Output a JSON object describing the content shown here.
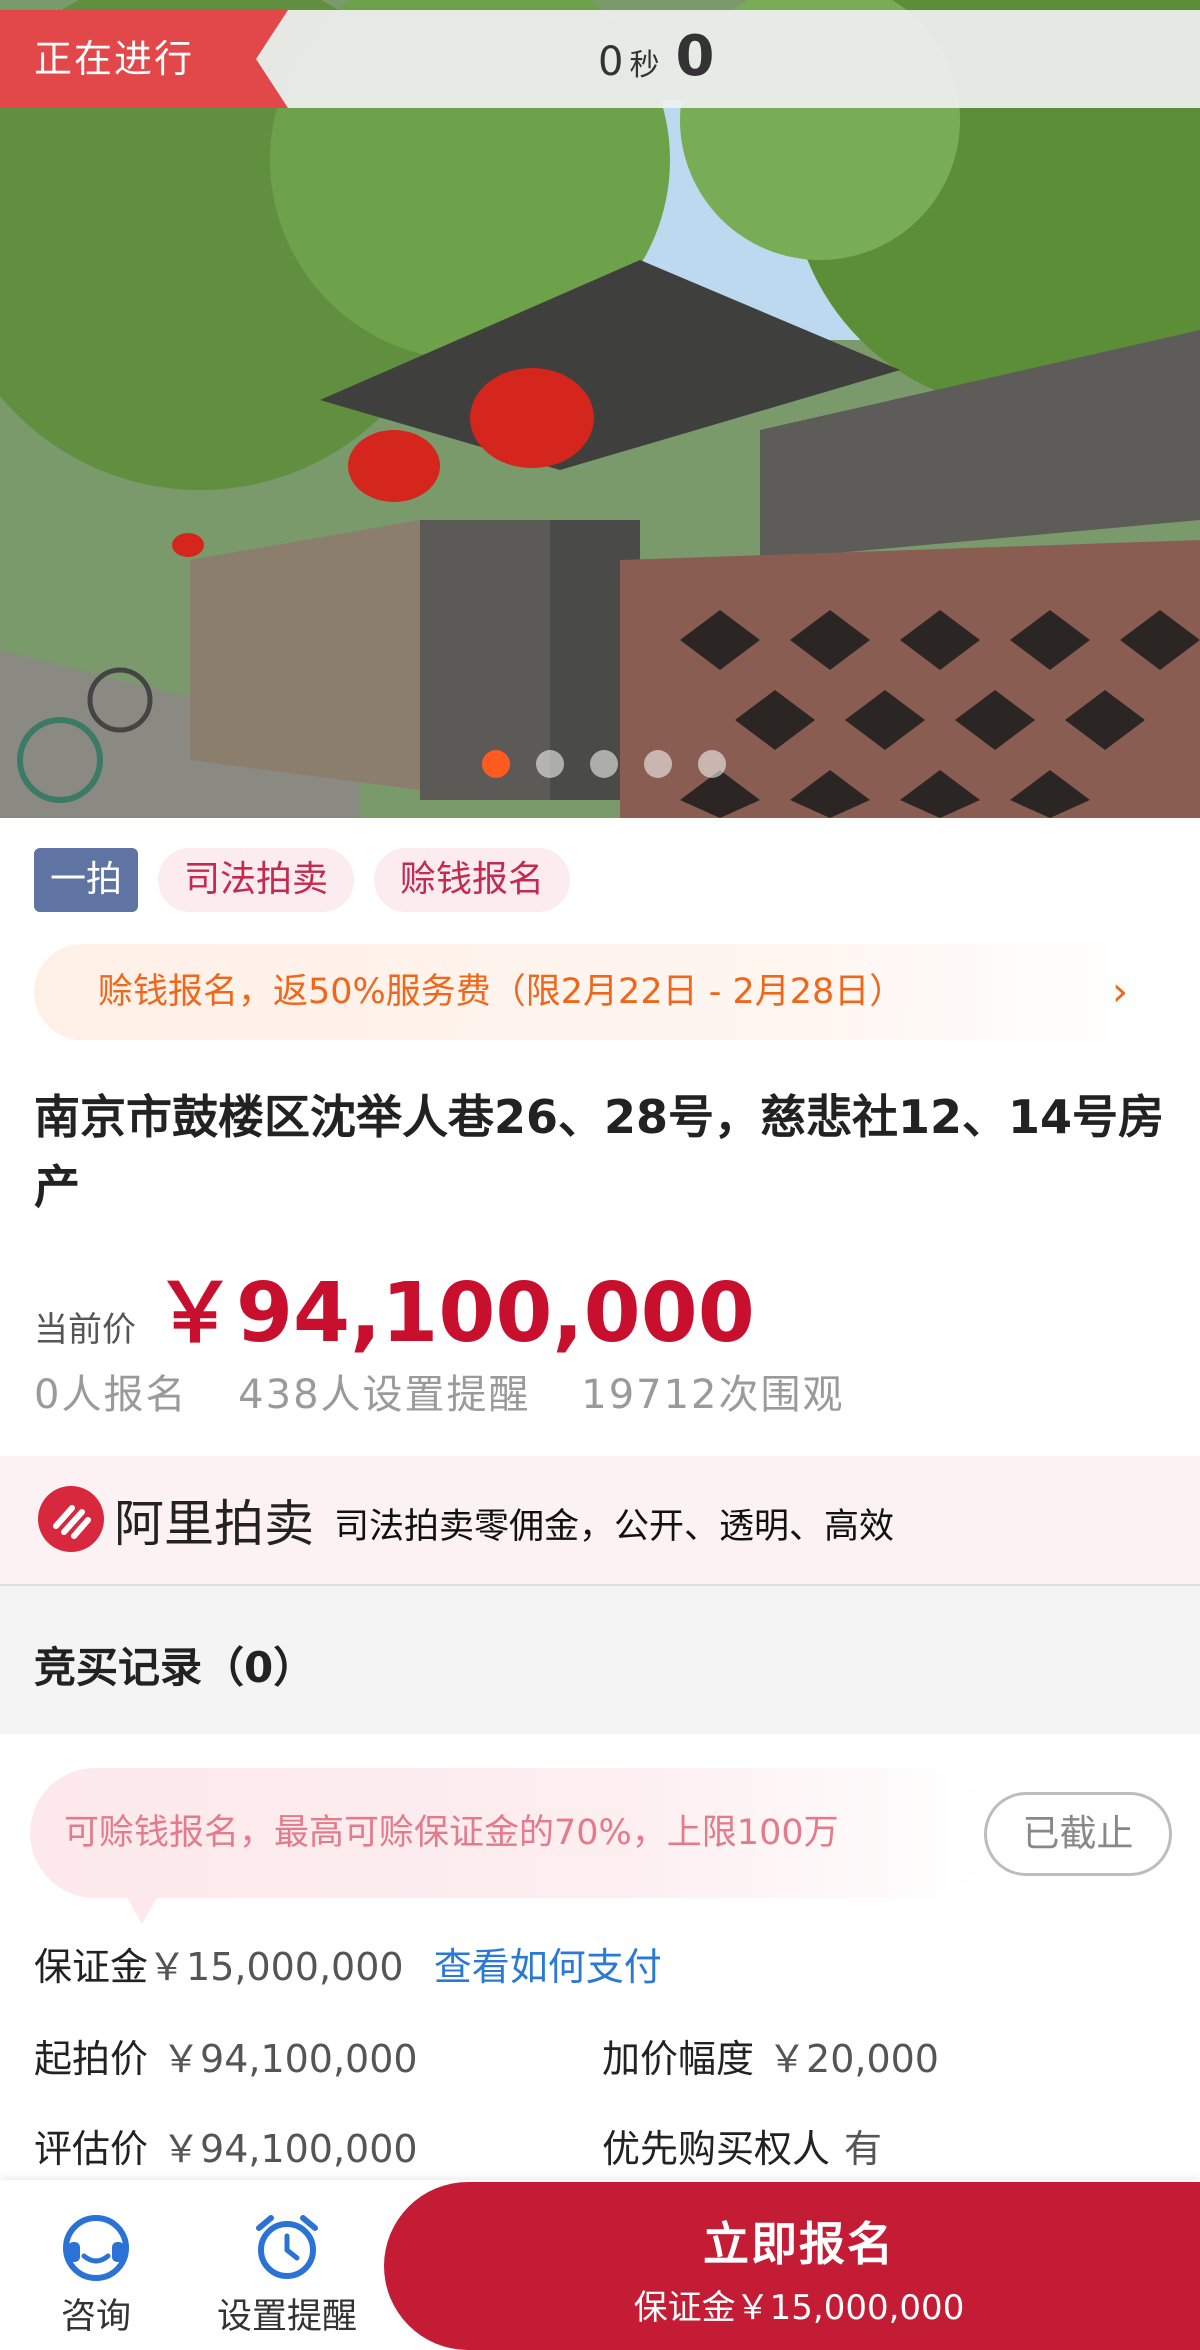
{
  "header": {
    "status": "正在进行",
    "countdown_num": "0",
    "countdown_unit": "秒",
    "countdown_big": "0"
  },
  "gallery": {
    "dots_total": 5,
    "active_index": 0
  },
  "tags": [
    "一拍",
    "司法拍卖",
    "赊钱报名"
  ],
  "promo": {
    "text": "赊钱报名，返50%服务费（限2月22日 - 2月28日）",
    "chevron": "›"
  },
  "title": "南京市鼓楼区沈举人巷26、28号，慈悲社12、14号房产",
  "price": {
    "label": "当前价",
    "value": "￥94,100,000"
  },
  "stats": {
    "signups": "0人报名",
    "reminders": "438人设置提醒",
    "views": "19712次围观"
  },
  "ali": {
    "brand": "阿里拍卖",
    "slogan": "司法拍卖零佣金，公开、透明、高效"
  },
  "records": {
    "title": "竞买记录（0）"
  },
  "credit": {
    "text": "可赊钱报名，最高可赊保证金的70%，上限100万",
    "status": "已截止"
  },
  "deposit": {
    "label": "保证金",
    "value": "￥15,000,000",
    "link": "查看如何支付"
  },
  "details": {
    "start_label": "起拍价",
    "start_value": "￥94,100,000",
    "increment_label": "加价幅度",
    "increment_value": "￥20,000",
    "appraisal_label": "评估价",
    "appraisal_value": "￥94,100,000",
    "priority_label": "优先购买权人",
    "priority_value": "有"
  },
  "bottom": {
    "consult": "咨询",
    "remind": "设置提醒",
    "cta_title": "立即报名",
    "cta_sub": "保证金￥15,000,000"
  },
  "colors": {
    "accent": "#c51c36",
    "promo": "#f0661a",
    "link": "#2a7ad5"
  }
}
